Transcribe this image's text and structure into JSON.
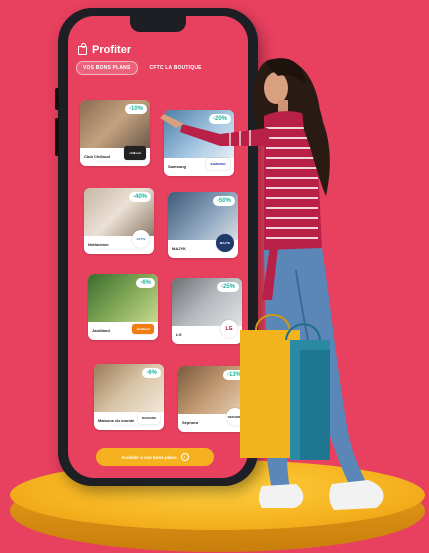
{
  "app": {
    "title": "Profiter",
    "title_icon": "gift-icon"
  },
  "tabs": [
    {
      "label": "VOS BONS PLANS",
      "active": true
    },
    {
      "label": "CFTC LA BOUTIQUE",
      "active": false
    }
  ],
  "offers": [
    {
      "name": "Club Chilloud",
      "discount": "-10%",
      "logo": "chilloud"
    },
    {
      "name": "Samsung",
      "discount": "-20%",
      "logo": "SAMSUNG"
    },
    {
      "name": "Nettoiemer",
      "discount": "-40%",
      "logo": "ACTIV"
    },
    {
      "name": "MAJYK",
      "discount": "-50%",
      "logo": "MAJYK"
    },
    {
      "name": "Jardiland",
      "discount": "-6%",
      "logo": "Jardiland"
    },
    {
      "name": "LG",
      "discount": "-25%",
      "logo": "LG"
    },
    {
      "name": "Maisons du monde",
      "discount": "-6%",
      "logo": "MAISONS"
    },
    {
      "name": "Sephora",
      "discount": "-13%",
      "logo": "SEPHORA"
    }
  ],
  "cta": {
    "label": "Accéder à vos bons plans",
    "icon": "info-icon"
  },
  "colors": {
    "background": "#e8405f",
    "accent": "#f5b21e",
    "badge_text": "#1ab7a0"
  }
}
